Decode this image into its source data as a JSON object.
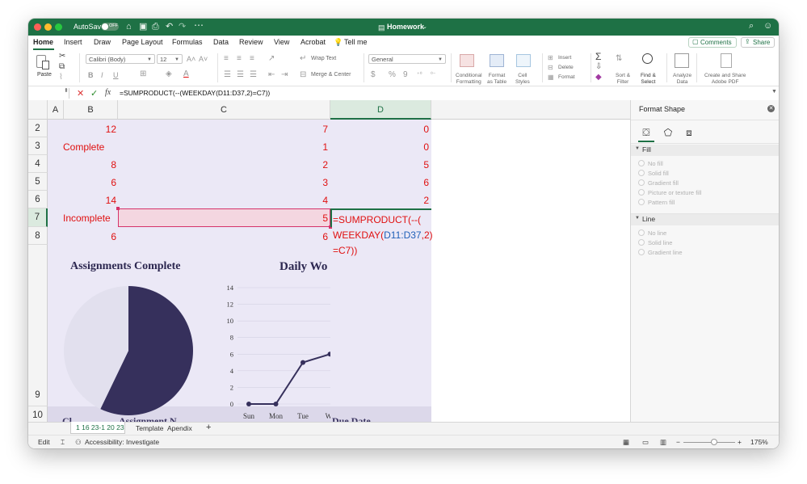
{
  "window": {
    "title": "Homework",
    "autosave_label": "AutoSave",
    "autosave_state": "OFF"
  },
  "ribbon_tabs": [
    "Home",
    "Insert",
    "Draw",
    "Page Layout",
    "Formulas",
    "Data",
    "Review",
    "View",
    "Acrobat",
    "Tell me"
  ],
  "ribbon": {
    "paste": "Paste",
    "font_name": "Calibri (Body)",
    "font_size": "12",
    "wrap_text": "Wrap Text",
    "merge_center": "Merge & Center",
    "number_format": "General",
    "currency": "$",
    "percent": "%",
    "comma": "9",
    "conditional_formatting_1": "Conditional",
    "conditional_formatting_2": "Formatting",
    "format_as_table_1": "Format",
    "format_as_table_2": "as Table",
    "cell_styles_1": "Cell",
    "cell_styles_2": "Styles",
    "insert": "Insert",
    "delete": "Delete",
    "format": "Format",
    "sort_filter_1": "Sort &",
    "sort_filter_2": "Filter",
    "find_select_1": "Find &",
    "find_select_2": "Select",
    "analyze_data_1": "Analyze",
    "analyze_data_2": "Data",
    "create_share_1": "Create and Share",
    "create_share_2": "Adobe PDF",
    "comments": "Comments",
    "share": "Share"
  },
  "formula_bar": {
    "name_box": "",
    "fx": "fx",
    "formula": "=SUMPRODUCT(--(WEEKDAY(D11:D37,2)=C7))"
  },
  "columns": [
    "A",
    "B",
    "C",
    "D"
  ],
  "rows": [
    {
      "num": "2",
      "b": "12",
      "c": "7",
      "d": "0"
    },
    {
      "num": "3",
      "b": "Complete",
      "c": "1",
      "d": "0"
    },
    {
      "num": "4",
      "b": "8",
      "c": "2",
      "d": "5"
    },
    {
      "num": "5",
      "b": "6",
      "c": "3",
      "d": "6"
    },
    {
      "num": "6",
      "b": "14",
      "c": "4",
      "d": "2"
    },
    {
      "num": "7",
      "b": "Incomplete",
      "c": "5",
      "d": ""
    },
    {
      "num": "8",
      "b": "6",
      "c": "6",
      "d": ""
    }
  ],
  "row9": "9",
  "row10": "10",
  "row10_cells": {
    "b": "Cl",
    "b2": "Assignment N",
    "d": "Due Date"
  },
  "formula_overlay": {
    "part1": "=SUMPRODUCT(--(",
    "part2a": "WEEKDAY(",
    "part2b": "D11:D37",
    "part2c": ",2)",
    "part3": "=C7))"
  },
  "pie_chart": {
    "title": "Assignments Complete",
    "colors": {
      "complete": "#36305c",
      "incomplete": "#e2e0ee"
    }
  },
  "chart_data": [
    {
      "type": "pie",
      "title": "Assignments Complete",
      "categories": [
        "Complete",
        "Incomplete"
      ],
      "values": [
        8,
        6
      ]
    },
    {
      "type": "line",
      "title": "Daily Wo",
      "categories": [
        "Sun",
        "Mon",
        "Tue",
        "We"
      ],
      "values": [
        0,
        0,
        5,
        6
      ],
      "yticks": [
        "0",
        "2",
        "4",
        "6",
        "8",
        "10",
        "12",
        "14"
      ],
      "ylim": [
        0,
        14
      ],
      "grid": true,
      "color": "#36305c"
    }
  ],
  "format_shape": {
    "title": "Format Shape",
    "fill_section": "Fill",
    "fill_options": [
      "No fill",
      "Solid fill",
      "Gradient fill",
      "Picture or texture fill",
      "Pattern fill"
    ],
    "line_section": "Line",
    "line_options": [
      "No line",
      "Solid line",
      "Gradient line"
    ]
  },
  "sheet_tabs": [
    "1 16 23-1 20 23",
    "Template",
    "Apendix"
  ],
  "add_sheet": "+",
  "status": {
    "mode": "Edit",
    "accessibility": "Accessibility: Investigate",
    "zoom": "175%",
    "minus": "−",
    "plus": "+"
  }
}
